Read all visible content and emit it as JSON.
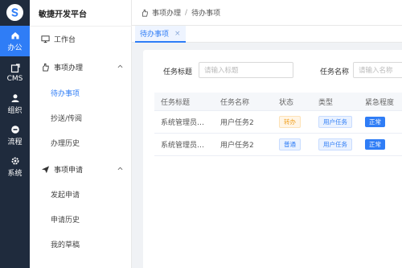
{
  "rail": {
    "items": [
      {
        "label": "办公",
        "icon": "home-icon",
        "active": true
      },
      {
        "label": "CMS",
        "icon": "cms-icon",
        "active": false
      },
      {
        "label": "组织",
        "icon": "user-icon",
        "active": false
      },
      {
        "label": "流程",
        "icon": "flow-icon",
        "active": false
      },
      {
        "label": "系统",
        "icon": "gear-icon",
        "active": false
      }
    ]
  },
  "sidebar": {
    "brand": "敏捷开发平台",
    "workbench": "工作台",
    "group1": {
      "label": "事项办理",
      "items": [
        "待办事项",
        "抄送/传阅",
        "办理历史"
      ]
    },
    "group2": {
      "label": "事项申请",
      "items": [
        "发起申请",
        "申请历史",
        "我的草稿"
      ]
    }
  },
  "breadcrumb": {
    "items": [
      "事项办理",
      "待办事项"
    ]
  },
  "tabs": [
    {
      "label": "待办事项",
      "close": "×"
    }
  ],
  "filters": {
    "title_label": "任务标题",
    "title_placeholder": "请输入标题",
    "name_label": "任务名称",
    "name_placeholder": "请输入名称"
  },
  "table": {
    "headers": [
      "任务标题",
      "任务名称",
      "状态",
      "类型",
      "紧急程度"
    ],
    "rows": [
      {
        "title": "系统管理员…",
        "name": "用户任务2",
        "status": "转办",
        "type": "用户任务",
        "urgency": "正常"
      },
      {
        "title": "系统管理员…",
        "name": "用户任务2",
        "status": "普通",
        "type": "用户任务",
        "urgency": "正常"
      }
    ]
  },
  "colors": {
    "accent": "#2f7df6",
    "rail_bg": "#1f2b3d",
    "transfer_tag": "#f0a020"
  }
}
